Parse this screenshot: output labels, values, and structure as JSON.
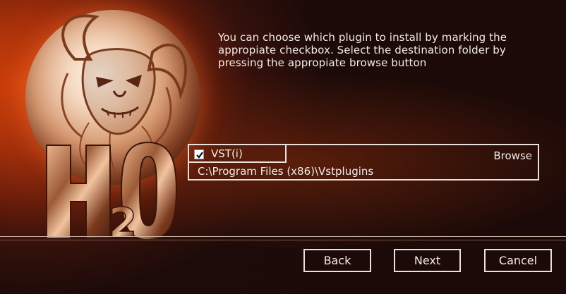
{
  "instructions": {
    "line1": "You can choose which plugin to install by marking the",
    "line2": "appropiate checkbox. Select the destination folder by",
    "line3": "pressing the appropiate browse button"
  },
  "plugin": {
    "name": "VST(i)",
    "checked": true,
    "browse_label": "Browse",
    "path": "C:\\Program Files (x86)\\Vstplugins"
  },
  "logo": {
    "letter_h": "H",
    "digit_2": "2",
    "letter_o": "O"
  },
  "navigation": {
    "back_label": "Back",
    "next_label": "Next",
    "cancel_label": "Cancel"
  },
  "colors": {
    "text": "#f2ece6",
    "border": "#e9e2dc",
    "background_accent": "#d2420b",
    "background_dark": "#1d0b09"
  },
  "icons": {
    "logo": "h2o-logo-icon",
    "check": "checkmark-icon"
  }
}
